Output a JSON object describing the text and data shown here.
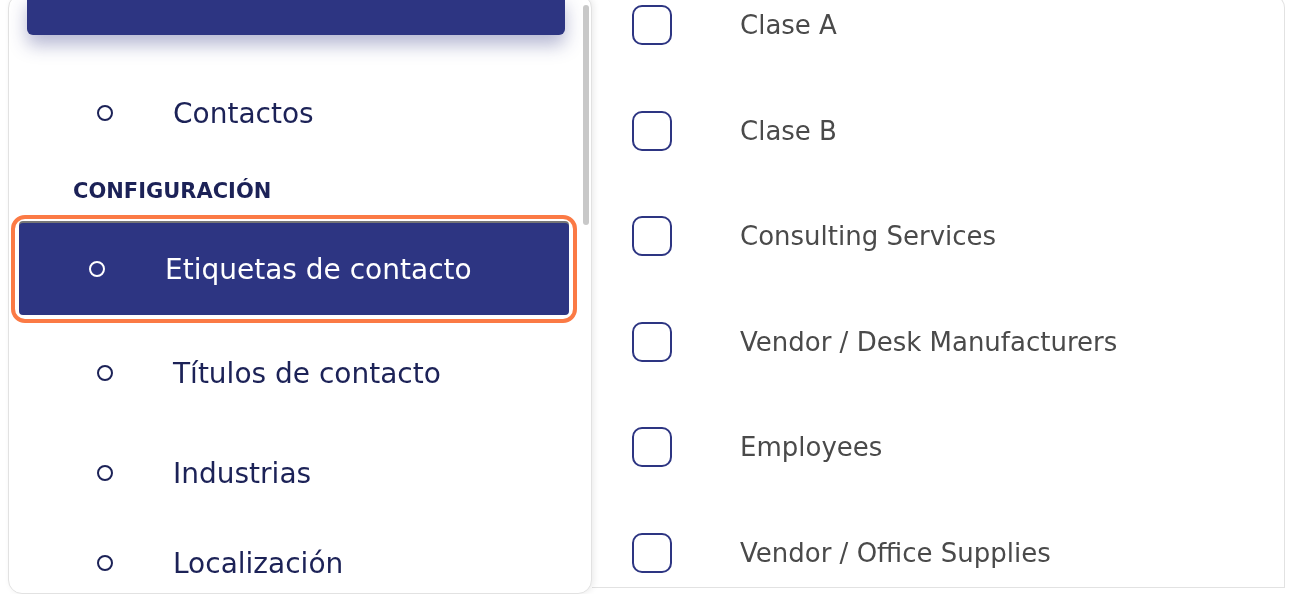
{
  "sidebar": {
    "items": [
      {
        "kind": "cut",
        "selected": true
      },
      {
        "kind": "link",
        "label": "Contactos",
        "selected": false,
        "highlighted": false
      },
      {
        "kind": "heading",
        "label": "CONFIGURACIÓN"
      },
      {
        "kind": "link",
        "label": "Etiquetas de contacto",
        "selected": true,
        "highlighted": true
      },
      {
        "kind": "link",
        "label": "Títulos de contacto",
        "selected": false,
        "highlighted": false
      },
      {
        "kind": "link",
        "label": "Industrias",
        "selected": false,
        "highlighted": false
      },
      {
        "kind": "link",
        "label": "Localización",
        "selected": false,
        "highlighted": false
      }
    ]
  },
  "tags": [
    {
      "label": "Clase A",
      "checked": false
    },
    {
      "label": "Clase B",
      "checked": false
    },
    {
      "label": "Consulting Services",
      "checked": false
    },
    {
      "label": "Vendor / Desk Manufacturers",
      "checked": false
    },
    {
      "label": "Employees",
      "checked": false
    },
    {
      "label": "Vendor / Office Supplies",
      "checked": false
    }
  ]
}
